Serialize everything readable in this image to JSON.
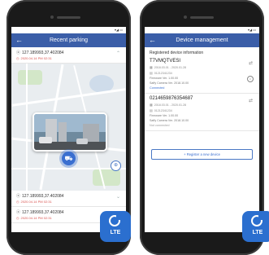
{
  "left": {
    "status_icons": "▾◢ ▭",
    "appbar": {
      "title": "Recent parking",
      "back_glyph": "←"
    },
    "entries": [
      {
        "coord": "127.189993,37.402084",
        "time": "2020.04.14 PM 02:31"
      },
      {
        "coord": "127.189993,37.402084",
        "time": "2020.04.14 PM 02:31"
      },
      {
        "coord": "127.189993,37.402084",
        "time": "2020.04.14 PM 02:31"
      }
    ]
  },
  "right": {
    "status_icons": "▾◢ ▭",
    "appbar": {
      "title": "Device management",
      "back_glyph": "←"
    },
    "subheader": "Registered device information",
    "devices": [
      {
        "name": "T7VMQTVESI",
        "date": "2018.03.01 - 2020.01.28",
        "id": "01212341234",
        "firmware": "Firmware Ver. 1.00.00",
        "camera": "Saffy Camera Ver. 2018.10.00",
        "status": "Connected"
      },
      {
        "name": "0214659876354687",
        "date": "2018.03.01 - 2020.01.28",
        "id": "01212341234",
        "firmware": "Firmware Ver. 1.00.00",
        "camera": "Saffy Camera Ver. 2018.10.00",
        "status": "Not connected"
      }
    ],
    "register_label": "+ Register a new device"
  },
  "badge": {
    "label": "LTE"
  },
  "colors": {
    "accent": "#3b5ea8",
    "badge": "#2b6fcf",
    "timestamp": "#d9534f",
    "connected": "#3a6fd0"
  }
}
